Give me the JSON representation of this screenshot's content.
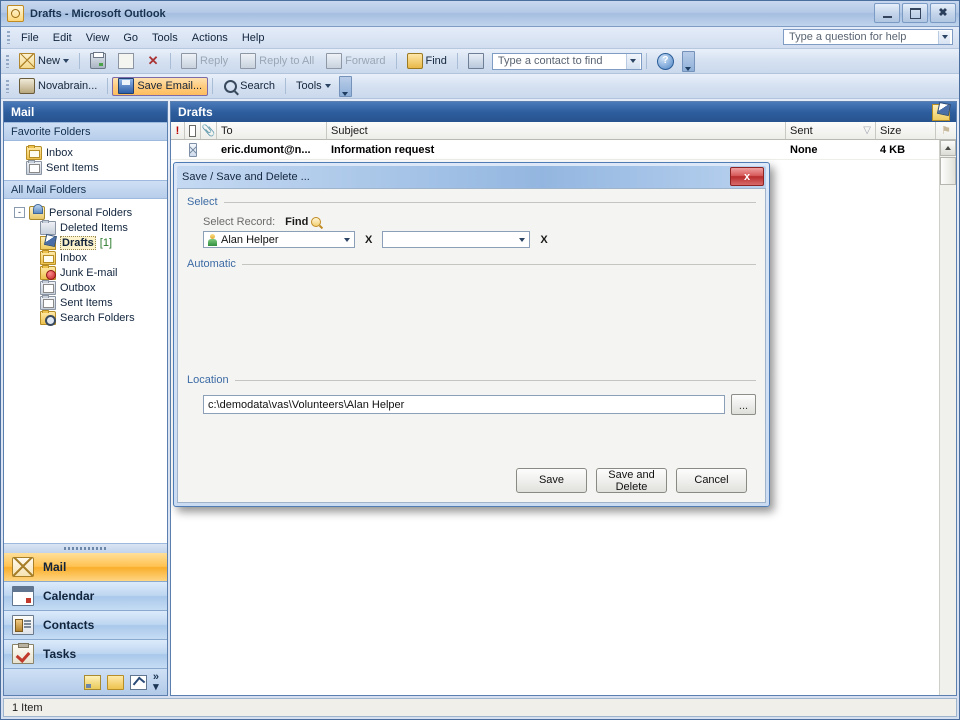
{
  "window": {
    "title": "Drafts - Microsoft Outlook",
    "app_icon": "outlook-icon",
    "buttons": {
      "minimize": "minimize-icon",
      "maximize": "maximize-icon",
      "close": "close-icon"
    }
  },
  "menu": {
    "items": [
      "File",
      "Edit",
      "View",
      "Go",
      "Tools",
      "Actions",
      "Help"
    ],
    "help_search_placeholder": "Type a question for help"
  },
  "toolbar_standard": {
    "new_label": "New",
    "print": "print-icon",
    "move": "move-to-folder-icon",
    "delete": "delete-icon",
    "reply": "Reply",
    "reply_all": "Reply to All",
    "forward": "Forward",
    "find": "Find",
    "address_book": "address-book-icon",
    "contact_placeholder": "Type a contact to find",
    "help": "help-icon"
  },
  "toolbar_addin": {
    "novabrain": "Novabrain...",
    "save_email": "Save Email...",
    "search": "Search",
    "tools": "Tools"
  },
  "nav_pane": {
    "header": "Mail",
    "favorite_folders_label": "Favorite Folders",
    "favorite_folders": [
      {
        "label": "Inbox",
        "icon": "inbox-folder-icon"
      },
      {
        "label": "Sent Items",
        "icon": "sent-items-folder-icon"
      }
    ],
    "all_mail_folders_label": "All Mail Folders",
    "root": {
      "label": "Personal Folders",
      "icon": "personal-folders-icon",
      "expander": "-"
    },
    "folders": [
      {
        "label": "Deleted Items",
        "icon": "deleted-items-icon",
        "count": "",
        "selected": false
      },
      {
        "label": "Drafts",
        "icon": "drafts-folder-icon",
        "count": "[1]",
        "selected": true
      },
      {
        "label": "Inbox",
        "icon": "inbox-folder-icon",
        "count": "",
        "selected": false
      },
      {
        "label": "Junk E-mail",
        "icon": "junk-email-icon",
        "count": "",
        "selected": false
      },
      {
        "label": "Outbox",
        "icon": "outbox-folder-icon",
        "count": "",
        "selected": false
      },
      {
        "label": "Sent Items",
        "icon": "sent-items-folder-icon",
        "count": "",
        "selected": false
      },
      {
        "label": "Search Folders",
        "icon": "search-folders-icon",
        "count": "",
        "selected": false
      }
    ],
    "modules": [
      {
        "label": "Mail",
        "icon": "mail-module-icon",
        "active": true
      },
      {
        "label": "Calendar",
        "icon": "calendar-module-icon",
        "active": false
      },
      {
        "label": "Contacts",
        "icon": "contacts-module-icon",
        "active": false
      },
      {
        "label": "Tasks",
        "icon": "tasks-module-icon",
        "active": false
      }
    ],
    "mini_buttons": [
      "notes-icon",
      "folder-list-icon",
      "shortcuts-icon",
      "configure-buttons-icon"
    ]
  },
  "list_pane": {
    "header": "Drafts",
    "header_icon": "drafts-folder-icon",
    "columns": {
      "importance": "!",
      "icon": "item-type-icon",
      "attachment": "attachment-icon",
      "to": "To",
      "subject": "Subject",
      "sent": "Sent",
      "size": "Size",
      "flag": "flag-icon"
    },
    "rows": [
      {
        "icon": "draft-message-icon",
        "to": "eric.dumont@n...",
        "subject": "Information request",
        "sent": "None",
        "size": "4 KB",
        "flag": "flag-icon"
      }
    ]
  },
  "status_bar": {
    "text": "1 Item"
  },
  "dialog": {
    "title": "Save / Save and Delete ...",
    "close_label": "x",
    "select_group": {
      "legend": "Select",
      "select_record_label": "Select Record:",
      "find_label": "Find",
      "find_icon": "find-magnifier-icon",
      "record_value": "Alan Helper",
      "record_icon": "contact-person-icon",
      "clear_1": "X",
      "second_value": "",
      "clear_2": "X"
    },
    "automatic_group": {
      "legend": "Automatic"
    },
    "location_group": {
      "legend": "Location",
      "path_value": "c:\\demodata\\vas\\Volunteers\\Alan Helper",
      "browse_label": "..."
    },
    "buttons": {
      "save": "Save",
      "save_and_delete_line1": "Save and",
      "save_and_delete_line2": "Delete",
      "cancel": "Cancel"
    }
  },
  "colors": {
    "title_blue": "#2e5e9e",
    "accent_orange": "#f9ae2c",
    "dialog_red": "#b92c2c",
    "group_legend": "#3d6ba5"
  }
}
